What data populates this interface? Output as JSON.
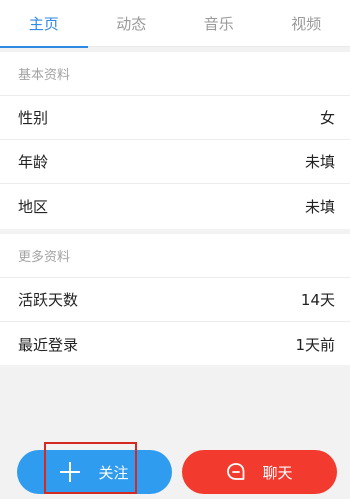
{
  "tabs": [
    {
      "label": "主页",
      "active": true
    },
    {
      "label": "动态",
      "active": false
    },
    {
      "label": "音乐",
      "active": false
    },
    {
      "label": "视频",
      "active": false
    }
  ],
  "basic_info": {
    "header": "基本资料",
    "rows": [
      {
        "label": "性别",
        "value": "女"
      },
      {
        "label": "年龄",
        "value": "未填"
      },
      {
        "label": "地区",
        "value": "未填"
      }
    ]
  },
  "more_info": {
    "header": "更多资料",
    "rows": [
      {
        "label": "活跃天数",
        "value": "14天"
      },
      {
        "label": "最近登录",
        "value": "1天前"
      }
    ]
  },
  "actions": {
    "follow_label": "关注",
    "chat_label": "聊天",
    "follow_icon": "plus-icon",
    "chat_icon": "chat-bubble-icon"
  },
  "colors": {
    "accent": "#2f8ae6",
    "follow_button": "#2f9cf0",
    "chat_button": "#f23a2f",
    "highlight": "#d42a22"
  }
}
